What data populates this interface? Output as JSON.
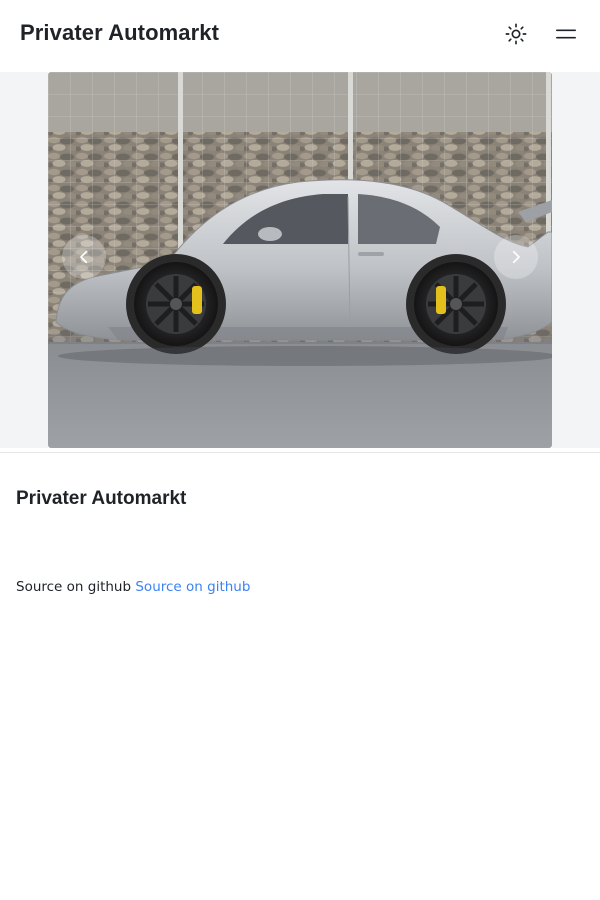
{
  "header": {
    "brand": "Privater Automarkt",
    "theme_toggle_icon": "sun-icon",
    "menu_icon": "menu-icon"
  },
  "carousel": {
    "slide_subject": "silver sports car parked in front of a stone gabion wall",
    "prev_icon": "chevron-left-icon",
    "next_icon": "chevron-right-icon"
  },
  "main": {
    "title": "Privater Automarkt",
    "source_text": "Source on github",
    "source_link": "Source on github"
  },
  "colors": {
    "link": "#3b82f6",
    "text": "#1f2328",
    "divider": "#e5e7eb"
  }
}
